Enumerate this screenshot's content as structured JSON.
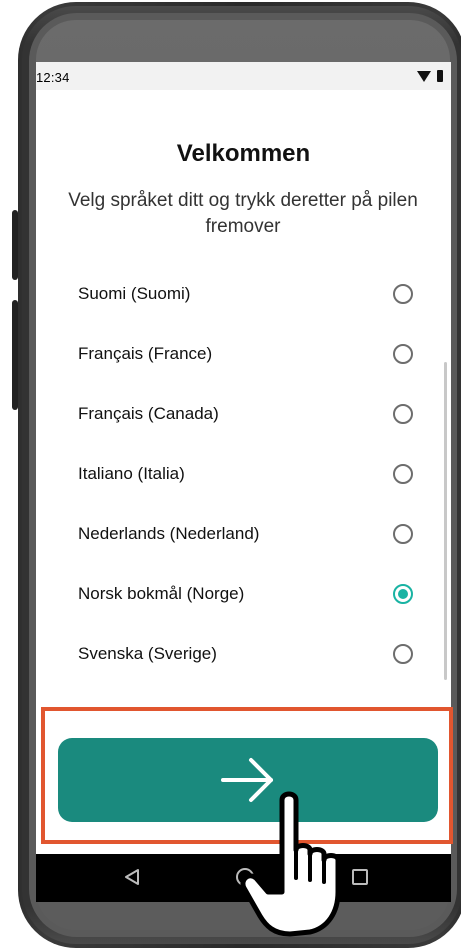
{
  "status_bar": {
    "time": "12:34",
    "wifi_icon": "wifi-icon",
    "battery_icon": "battery-icon"
  },
  "header": {
    "title": "Velkommen",
    "subtitle": "Velg språket ditt og trykk deretter på pilen fremover"
  },
  "languages": [
    {
      "label": "Suomi (Suomi)",
      "selected": false
    },
    {
      "label": "Français (France)",
      "selected": false
    },
    {
      "label": "Français (Canada)",
      "selected": false
    },
    {
      "label": "Italiano (Italia)",
      "selected": false
    },
    {
      "label": "Nederlands (Nederland)",
      "selected": false
    },
    {
      "label": "Norsk bokmål (Norge)",
      "selected": true
    },
    {
      "label": "Svenska (Sverige)",
      "selected": false
    }
  ],
  "next_button": {
    "icon": "arrow-right-icon"
  },
  "nav_bar": {
    "back_icon": "back-icon",
    "home_icon": "home-icon",
    "recents_icon": "recents-icon"
  },
  "overlay": {
    "highlight_color": "#e1562f",
    "cursor_icon": "hand-pointer-icon"
  },
  "colors": {
    "accent": "#19b3a3",
    "button": "#1a8a7e"
  }
}
